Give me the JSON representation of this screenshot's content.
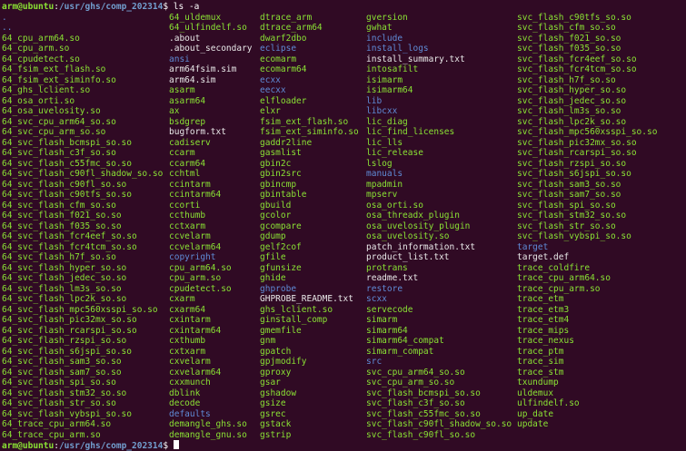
{
  "prompt": {
    "user_host": "arm@ubuntu",
    "colon": ":",
    "path": "/usr/ghs/comp_202314",
    "dollar": "$ ",
    "command": "ls -a"
  },
  "colors": {
    "background": "#300a24",
    "file": "#e9e9e9",
    "executable": "#8ae234",
    "directory": "#5f8bd6",
    "prompt_user": "#8ae234",
    "prompt_path": "#729fcf"
  },
  "listing": {
    "columns": [
      [
        {
          "name": ".",
          "type": "dir"
        },
        {
          "name": "..",
          "type": "dir"
        },
        {
          "name": "64_cpu_arm64.so",
          "type": "so"
        },
        {
          "name": "64_cpu_arm.so",
          "type": "so"
        },
        {
          "name": "64_cpudetect.so",
          "type": "so"
        },
        {
          "name": "64_fsim_ext_flash.so",
          "type": "so"
        },
        {
          "name": "64_fsim_ext_siminfo.so",
          "type": "so"
        },
        {
          "name": "64_ghs_lclient.so",
          "type": "so"
        },
        {
          "name": "64_osa_orti.so",
          "type": "so"
        },
        {
          "name": "64_osa_uvelosity.so",
          "type": "so"
        },
        {
          "name": "64_svc_cpu_arm64_so.so",
          "type": "so"
        },
        {
          "name": "64_svc_cpu_arm_so.so",
          "type": "so"
        },
        {
          "name": "64_svc_flash_bcmspi_so.so",
          "type": "so"
        },
        {
          "name": "64_svc_flash_c3f_so.so",
          "type": "so"
        },
        {
          "name": "64_svc_flash_c55fmc_so.so",
          "type": "so"
        },
        {
          "name": "64_svc_flash_c90fl_shadow_so.so",
          "type": "so"
        },
        {
          "name": "64_svc_flash_c90fl_so.so",
          "type": "so"
        },
        {
          "name": "64_svc_flash_c90tfs_so.so",
          "type": "so"
        },
        {
          "name": "64_svc_flash_cfm_so.so",
          "type": "so"
        },
        {
          "name": "64_svc_flash_f021_so.so",
          "type": "so"
        },
        {
          "name": "64_svc_flash_f035_so.so",
          "type": "so"
        },
        {
          "name": "64_svc_flash_fcr4eef_so.so",
          "type": "so"
        },
        {
          "name": "64_svc_flash_fcr4tcm_so.so",
          "type": "so"
        },
        {
          "name": "64_svc_flash_h7f_so.so",
          "type": "so"
        },
        {
          "name": "64_svc_flash_hyper_so.so",
          "type": "so"
        },
        {
          "name": "64_svc_flash_jedec_so.so",
          "type": "so"
        },
        {
          "name": "64_svc_flash_lm3s_so.so",
          "type": "so"
        },
        {
          "name": "64_svc_flash_lpc2k_so.so",
          "type": "so"
        },
        {
          "name": "64_svc_flash_mpc560xsspi_so.so",
          "type": "so"
        },
        {
          "name": "64_svc_flash_pic32mx_so.so",
          "type": "so"
        },
        {
          "name": "64_svc_flash_rcarspi_so.so",
          "type": "so"
        },
        {
          "name": "64_svc_flash_rzspi_so.so",
          "type": "so"
        },
        {
          "name": "64_svc_flash_s6jspi_so.so",
          "type": "so"
        },
        {
          "name": "64_svc_flash_sam3_so.so",
          "type": "so"
        },
        {
          "name": "64_svc_flash_sam7_so.so",
          "type": "so"
        },
        {
          "name": "64_svc_flash_spi_so.so",
          "type": "so"
        },
        {
          "name": "64_svc_flash_stm32_so.so",
          "type": "so"
        },
        {
          "name": "64_svc_flash_str_so.so",
          "type": "so"
        },
        {
          "name": "64_svc_flash_vybspi_so.so",
          "type": "so"
        },
        {
          "name": "64_trace_cpu_arm64.so",
          "type": "so"
        },
        {
          "name": "64_trace_cpu_arm.so",
          "type": "so"
        }
      ],
      [
        {
          "name": "64_uldemux",
          "type": "so"
        },
        {
          "name": "64_ulfindelf.so",
          "type": "so"
        },
        {
          "name": ".about",
          "type": "file"
        },
        {
          "name": ".about_secondary",
          "type": "file"
        },
        {
          "name": "ansi",
          "type": "dir"
        },
        {
          "name": "arm64fsim.sim",
          "type": "file"
        },
        {
          "name": "arm64.sim",
          "type": "file"
        },
        {
          "name": "asarm",
          "type": "so"
        },
        {
          "name": "asarm64",
          "type": "so"
        },
        {
          "name": "ax",
          "type": "so"
        },
        {
          "name": "bsdgrep",
          "type": "so"
        },
        {
          "name": "bugform.txt",
          "type": "file"
        },
        {
          "name": "cadiserv",
          "type": "so"
        },
        {
          "name": "ccarm",
          "type": "so"
        },
        {
          "name": "ccarm64",
          "type": "so"
        },
        {
          "name": "cchtml",
          "type": "so"
        },
        {
          "name": "ccintarm",
          "type": "so"
        },
        {
          "name": "ccintarm64",
          "type": "so"
        },
        {
          "name": "ccorti",
          "type": "so"
        },
        {
          "name": "ccthumb",
          "type": "so"
        },
        {
          "name": "cctxarm",
          "type": "so"
        },
        {
          "name": "ccvelarm",
          "type": "so"
        },
        {
          "name": "ccvelarm64",
          "type": "so"
        },
        {
          "name": "copyright",
          "type": "dir"
        },
        {
          "name": "cpu_arm64.so",
          "type": "so"
        },
        {
          "name": "cpu_arm.so",
          "type": "so"
        },
        {
          "name": "cpudetect.so",
          "type": "so"
        },
        {
          "name": "cxarm",
          "type": "so"
        },
        {
          "name": "cxarm64",
          "type": "so"
        },
        {
          "name": "cxintarm",
          "type": "so"
        },
        {
          "name": "cxintarm64",
          "type": "so"
        },
        {
          "name": "cxthumb",
          "type": "so"
        },
        {
          "name": "cxtxarm",
          "type": "so"
        },
        {
          "name": "cxvelarm",
          "type": "so"
        },
        {
          "name": "cxvelarm64",
          "type": "so"
        },
        {
          "name": "cxxmunch",
          "type": "so"
        },
        {
          "name": "dblink",
          "type": "so"
        },
        {
          "name": "decode",
          "type": "so"
        },
        {
          "name": "defaults",
          "type": "dir"
        },
        {
          "name": "demangle_ghs.so",
          "type": "so"
        },
        {
          "name": "demangle_gnu.so",
          "type": "so"
        }
      ],
      [
        {
          "name": "dtrace_arm",
          "type": "so"
        },
        {
          "name": "dtrace_arm64",
          "type": "so"
        },
        {
          "name": "dwarf2dbo",
          "type": "so"
        },
        {
          "name": "eclipse",
          "type": "dir"
        },
        {
          "name": "ecomarm",
          "type": "so"
        },
        {
          "name": "ecomarm64",
          "type": "so"
        },
        {
          "name": "ecxx",
          "type": "dir"
        },
        {
          "name": "eecxx",
          "type": "dir"
        },
        {
          "name": "elfloader",
          "type": "so"
        },
        {
          "name": "elxr",
          "type": "so"
        },
        {
          "name": "fsim_ext_flash.so",
          "type": "so"
        },
        {
          "name": "fsim_ext_siminfo.so",
          "type": "so"
        },
        {
          "name": "gaddr2line",
          "type": "so"
        },
        {
          "name": "gasmlist",
          "type": "so"
        },
        {
          "name": "gbin2c",
          "type": "so"
        },
        {
          "name": "gbin2src",
          "type": "so"
        },
        {
          "name": "gbincmp",
          "type": "so"
        },
        {
          "name": "gbintable",
          "type": "so"
        },
        {
          "name": "gbuild",
          "type": "so"
        },
        {
          "name": "gcolor",
          "type": "so"
        },
        {
          "name": "gcompare",
          "type": "so"
        },
        {
          "name": "gdump",
          "type": "so"
        },
        {
          "name": "gelf2cof",
          "type": "so"
        },
        {
          "name": "gfile",
          "type": "so"
        },
        {
          "name": "gfunsize",
          "type": "so"
        },
        {
          "name": "ghide",
          "type": "so"
        },
        {
          "name": "ghprobe",
          "type": "dir"
        },
        {
          "name": "GHPROBE_README.txt",
          "type": "file"
        },
        {
          "name": "ghs_lclient.so",
          "type": "so"
        },
        {
          "name": "ginstall_comp",
          "type": "so"
        },
        {
          "name": "gmemfile",
          "type": "so"
        },
        {
          "name": "gnm",
          "type": "so"
        },
        {
          "name": "gpatch",
          "type": "so"
        },
        {
          "name": "gpjmodify",
          "type": "so"
        },
        {
          "name": "gproxy",
          "type": "so"
        },
        {
          "name": "gsar",
          "type": "so"
        },
        {
          "name": "gshadow",
          "type": "so"
        },
        {
          "name": "gsize",
          "type": "so"
        },
        {
          "name": "gsrec",
          "type": "so"
        },
        {
          "name": "gstack",
          "type": "so"
        },
        {
          "name": "gstrip",
          "type": "so"
        }
      ],
      [
        {
          "name": "gversion",
          "type": "so"
        },
        {
          "name": "gwhat",
          "type": "so"
        },
        {
          "name": "include",
          "type": "dir"
        },
        {
          "name": "install_logs",
          "type": "dir"
        },
        {
          "name": "install_summary.txt",
          "type": "file"
        },
        {
          "name": "intosafilt",
          "type": "so"
        },
        {
          "name": "isimarm",
          "type": "so"
        },
        {
          "name": "isimarm64",
          "type": "so"
        },
        {
          "name": "lib",
          "type": "dir"
        },
        {
          "name": "libcxx",
          "type": "dir"
        },
        {
          "name": "lic_diag",
          "type": "so"
        },
        {
          "name": "lic_find_licenses",
          "type": "so"
        },
        {
          "name": "lic_lls",
          "type": "so"
        },
        {
          "name": "lic_release",
          "type": "so"
        },
        {
          "name": "lslog",
          "type": "so"
        },
        {
          "name": "manuals",
          "type": "dir"
        },
        {
          "name": "mpadmin",
          "type": "so"
        },
        {
          "name": "mpserv",
          "type": "so"
        },
        {
          "name": "osa_orti.so",
          "type": "so"
        },
        {
          "name": "osa_threadx_plugin",
          "type": "so"
        },
        {
          "name": "osa_uvelosity_plugin",
          "type": "so"
        },
        {
          "name": "osa_uvelosity.so",
          "type": "so"
        },
        {
          "name": "patch_information.txt",
          "type": "file"
        },
        {
          "name": "product_list.txt",
          "type": "file"
        },
        {
          "name": "protrans",
          "type": "so"
        },
        {
          "name": "readme.txt",
          "type": "file"
        },
        {
          "name": "restore",
          "type": "dir"
        },
        {
          "name": "scxx",
          "type": "dir"
        },
        {
          "name": "servecode",
          "type": "so"
        },
        {
          "name": "simarm",
          "type": "so"
        },
        {
          "name": "simarm64",
          "type": "so"
        },
        {
          "name": "simarm64_compat",
          "type": "so"
        },
        {
          "name": "simarm_compat",
          "type": "so"
        },
        {
          "name": "src",
          "type": "dir"
        },
        {
          "name": "svc_cpu_arm64_so.so",
          "type": "so"
        },
        {
          "name": "svc_cpu_arm_so.so",
          "type": "so"
        },
        {
          "name": "svc_flash_bcmspi_so.so",
          "type": "so"
        },
        {
          "name": "svc_flash_c3f_so.so",
          "type": "so"
        },
        {
          "name": "svc_flash_c55fmc_so.so",
          "type": "so"
        },
        {
          "name": "svc_flash_c90fl_shadow_so.so",
          "type": "so"
        },
        {
          "name": "svc_flash_c90fl_so.so",
          "type": "so"
        }
      ],
      [
        {
          "name": "svc_flash_c90tfs_so.so",
          "type": "so"
        },
        {
          "name": "svc_flash_cfm_so.so",
          "type": "so"
        },
        {
          "name": "svc_flash_f021_so.so",
          "type": "so"
        },
        {
          "name": "svc_flash_f035_so.so",
          "type": "so"
        },
        {
          "name": "svc_flash_fcr4eef_so.so",
          "type": "so"
        },
        {
          "name": "svc_flash_fcr4tcm_so.so",
          "type": "so"
        },
        {
          "name": "svc_flash_h7f_so.so",
          "type": "so"
        },
        {
          "name": "svc_flash_hyper_so.so",
          "type": "so"
        },
        {
          "name": "svc_flash_jedec_so.so",
          "type": "so"
        },
        {
          "name": "svc_flash_lm3s_so.so",
          "type": "so"
        },
        {
          "name": "svc_flash_lpc2k_so.so",
          "type": "so"
        },
        {
          "name": "svc_flash_mpc560xsspi_so.so",
          "type": "so"
        },
        {
          "name": "svc_flash_pic32mx_so.so",
          "type": "so"
        },
        {
          "name": "svc_flash_rcarspi_so.so",
          "type": "so"
        },
        {
          "name": "svc_flash_rzspi_so.so",
          "type": "so"
        },
        {
          "name": "svc_flash_s6jspi_so.so",
          "type": "so"
        },
        {
          "name": "svc_flash_sam3_so.so",
          "type": "so"
        },
        {
          "name": "svc_flash_sam7_so.so",
          "type": "so"
        },
        {
          "name": "svc_flash_spi_so.so",
          "type": "so"
        },
        {
          "name": "svc_flash_stm32_so.so",
          "type": "so"
        },
        {
          "name": "svc_flash_str_so.so",
          "type": "so"
        },
        {
          "name": "svc_flash_vybspi_so.so",
          "type": "so"
        },
        {
          "name": "target",
          "type": "dir"
        },
        {
          "name": "target.def",
          "type": "file"
        },
        {
          "name": "trace_coldfire",
          "type": "so"
        },
        {
          "name": "trace_cpu_arm64.so",
          "type": "so"
        },
        {
          "name": "trace_cpu_arm.so",
          "type": "so"
        },
        {
          "name": "trace_etm",
          "type": "so"
        },
        {
          "name": "trace_etm3",
          "type": "so"
        },
        {
          "name": "trace_etm4",
          "type": "so"
        },
        {
          "name": "trace_mips",
          "type": "so"
        },
        {
          "name": "trace_nexus",
          "type": "so"
        },
        {
          "name": "trace_ptm",
          "type": "so"
        },
        {
          "name": "trace_sim",
          "type": "so"
        },
        {
          "name": "trace_stm",
          "type": "so"
        },
        {
          "name": "txundump",
          "type": "so"
        },
        {
          "name": "uldemux",
          "type": "so"
        },
        {
          "name": "ulfindelf.so",
          "type": "so"
        },
        {
          "name": "up_date",
          "type": "so"
        },
        {
          "name": "update",
          "type": "so"
        }
      ]
    ]
  }
}
